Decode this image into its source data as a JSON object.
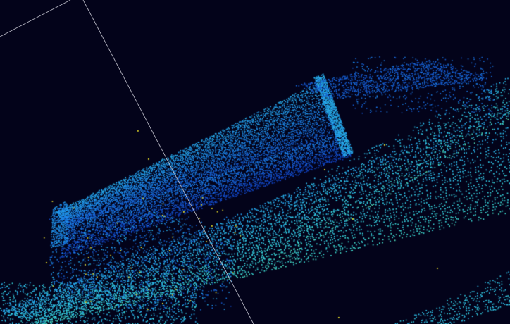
{
  "viewer": {
    "background_color": "#03031a",
    "colormap": [
      "#0a1e8a",
      "#1450d2",
      "#1e8cf0",
      "#2dbef0",
      "#3cdcd2",
      "#8ce678",
      "#e6e632"
    ],
    "bounding_box_color": "#d2d2dc",
    "outlier_point_color": "#e6dc28",
    "objects": [
      {
        "label": "elevated-structure",
        "shape": "tapered-box-with-end-wall"
      },
      {
        "label": "ground-surface",
        "shape": "sloped-plane-strips"
      },
      {
        "label": "under-structure-cluster",
        "shape": "irregular-cluster"
      }
    ]
  }
}
